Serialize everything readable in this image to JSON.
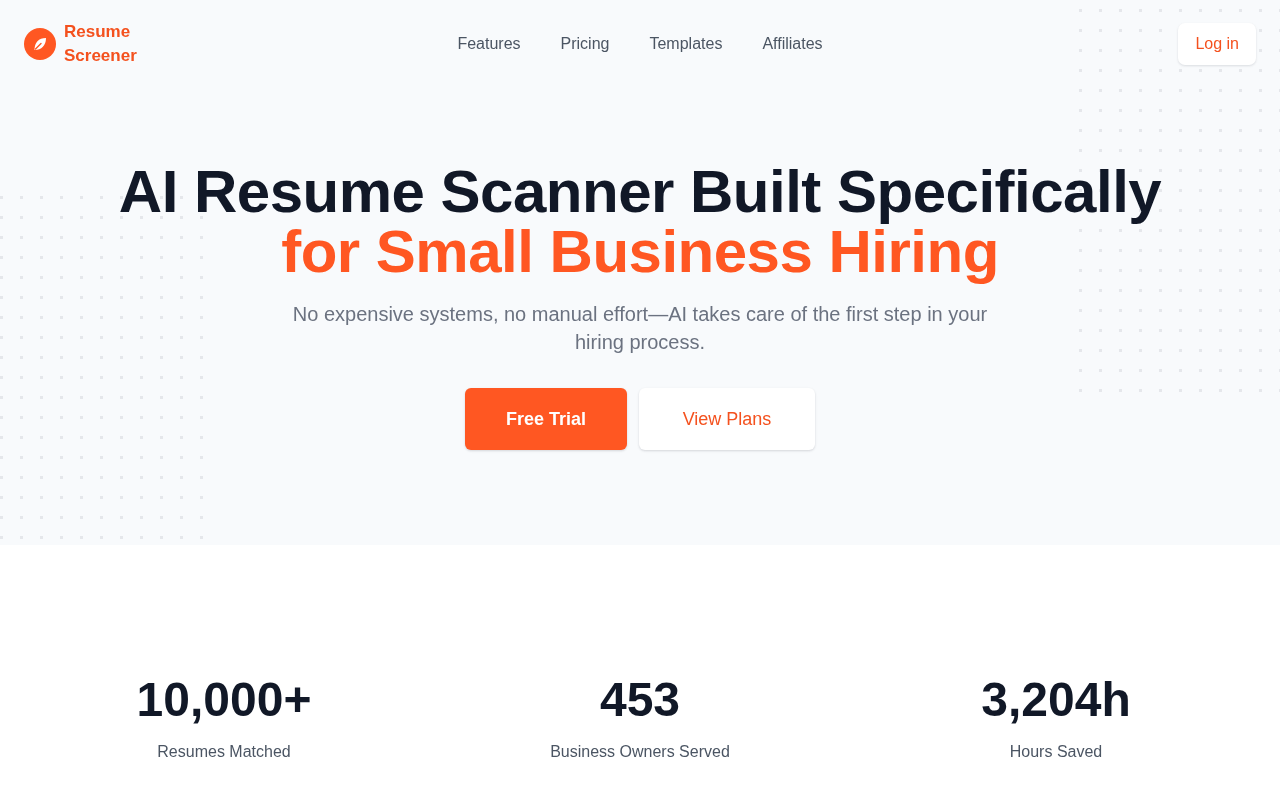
{
  "header": {
    "brand": "Resume Screener",
    "nav": [
      {
        "label": "Features"
      },
      {
        "label": "Pricing"
      },
      {
        "label": "Templates"
      },
      {
        "label": "Affiliates"
      }
    ],
    "login_button": "Log in"
  },
  "hero": {
    "title": "AI Resume Scanner Built Specifically",
    "title_highlight": "for Small Business Hiring",
    "subtitle": "No expensive systems, no manual effort—AI takes care of the first step in your hiring process.",
    "buttons": [
      {
        "label": "Free Trial",
        "kind": "primary"
      },
      {
        "label": "View Plans",
        "kind": "secondary"
      }
    ]
  },
  "stats": [
    {
      "value": "10,000+",
      "label": "Resumes Matched"
    },
    {
      "value": "453",
      "label": "Business Owners Served"
    },
    {
      "value": "3,204h",
      "label": "Hours Saved"
    }
  ]
}
